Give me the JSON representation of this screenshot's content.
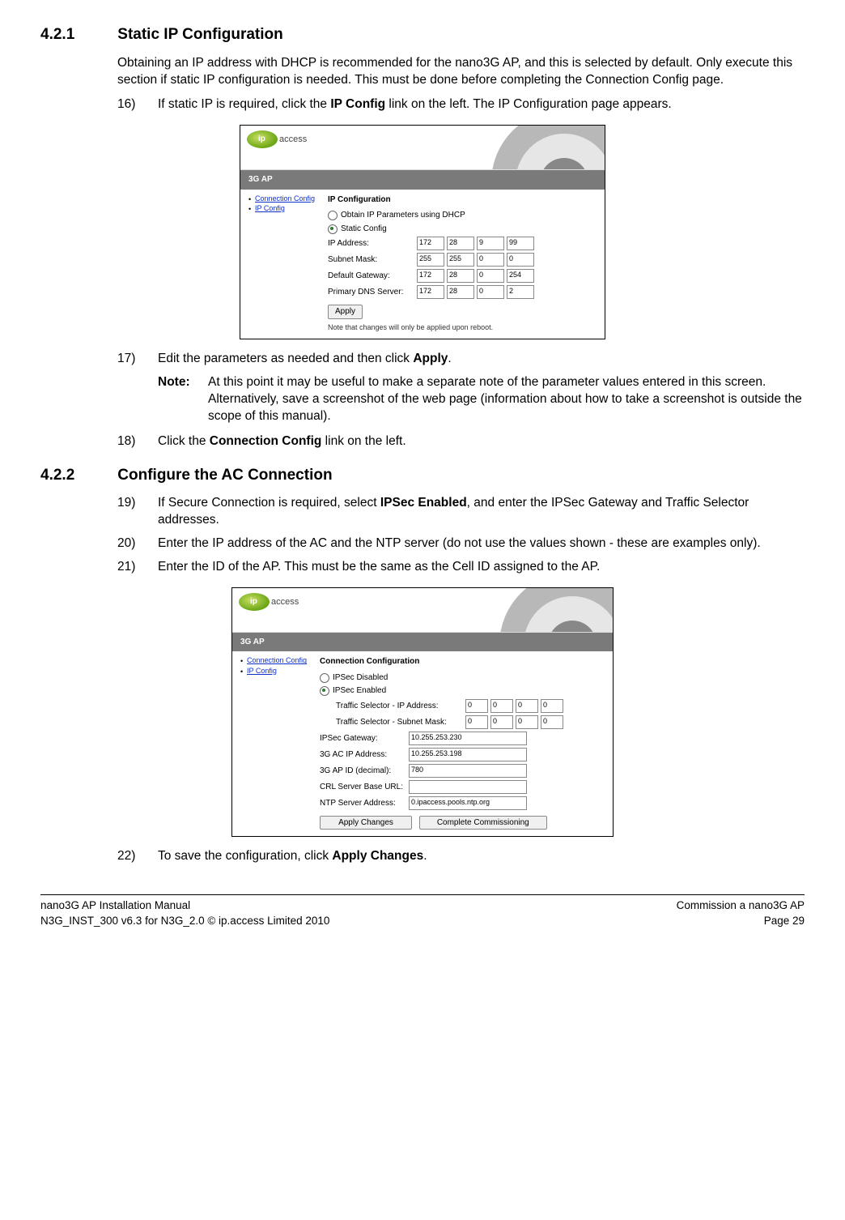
{
  "sec421": {
    "num": "4.2.1",
    "title": "Static IP Configuration"
  },
  "intro421": "Obtaining an IP address with DHCP is recommended for the nano3G AP, and this is selected by default. Only execute this section if static IP configuration is needed. This must be done before completing the Connection Config page.",
  "step16": {
    "num": "16)",
    "pre": "If static IP is required, click the ",
    "bold": "IP Config",
    "post": " link on the left. The IP Configuration page appears."
  },
  "shot1": {
    "logo_text": "access",
    "banner": "3G AP",
    "nav1": "Connection Config",
    "nav2": "IP Config",
    "title": "IP Configuration",
    "opt_dhcp": "Obtain IP Parameters using DHCP",
    "opt_static": "Static Config",
    "lbl_ip": "IP Address:",
    "lbl_mask": "Subnet Mask:",
    "lbl_gw": "Default Gateway:",
    "lbl_dns": "Primary DNS Server:",
    "ip": [
      "172",
      "28",
      "9",
      "99"
    ],
    "mask": [
      "255",
      "255",
      "0",
      "0"
    ],
    "gw": [
      "172",
      "28",
      "0",
      "254"
    ],
    "dns": [
      "172",
      "28",
      "0",
      "2"
    ],
    "apply": "Apply",
    "note": "Note that changes will only be applied upon reboot."
  },
  "step17": {
    "num": "17)",
    "pre": "Edit the parameters as needed and then click ",
    "bold": "Apply",
    "post": "."
  },
  "note17": {
    "label": "Note:",
    "text": "At this point it may be useful to make a separate note of the parameter values entered in this screen. Alternatively, save a screenshot of the web page (information about how to take a screenshot is outside the scope of this manual)."
  },
  "step18": {
    "num": "18)",
    "pre": "Click the ",
    "bold": "Connection Config",
    "post": " link on the left."
  },
  "sec422": {
    "num": "4.2.2",
    "title": "Configure the AC Connection"
  },
  "step19": {
    "num": "19)",
    "pre": "If Secure Connection is required, select ",
    "bold": "IPSec Enabled",
    "post": ", and enter the IPSec Gateway and Traffic Selector addresses."
  },
  "step20": {
    "num": "20)",
    "text": "Enter the IP address of the AC and the NTP server (do not use the values shown - these are examples only)."
  },
  "step21": {
    "num": "21)",
    "text": "Enter the ID of the AP. This must be the same as the Cell ID assigned to the AP."
  },
  "shot2": {
    "logo_text": "access",
    "banner": "3G AP",
    "nav1": "Connection Config",
    "nav2": "IP Config",
    "title": "Connection Configuration",
    "opt_dis": "IPSec Disabled",
    "opt_en": "IPSec Enabled",
    "lbl_ts_ip": "Traffic Selector - IP Address:",
    "lbl_ts_mask": "Traffic Selector - Subnet Mask:",
    "ts_ip": [
      "0",
      "0",
      "0",
      "0"
    ],
    "ts_mask": [
      "0",
      "0",
      "0",
      "0"
    ],
    "lbl_gw": "IPSec Gateway:",
    "lbl_ac": "3G AC IP Address:",
    "lbl_apid": "3G AP ID (decimal):",
    "lbl_crl": "CRL Server Base URL:",
    "lbl_ntp": "NTP Server Address:",
    "val_gw": "10.255.253.230",
    "val_ac": "10.255.253.198",
    "val_apid": "780",
    "val_crl": "",
    "val_ntp": "0.ipaccess.pools.ntp.org",
    "btn_apply": "Apply Changes",
    "btn_complete": "Complete Commissioning"
  },
  "step22": {
    "num": "22)",
    "pre": "To save the configuration, click ",
    "bold": "Apply Changes",
    "post": "."
  },
  "footer": {
    "l1": "nano3G AP Installation Manual",
    "l2": "N3G_INST_300 v6.3 for N3G_2.0 © ip.access Limited 2010",
    "r1": "Commission a nano3G AP",
    "r2": "Page 29"
  }
}
